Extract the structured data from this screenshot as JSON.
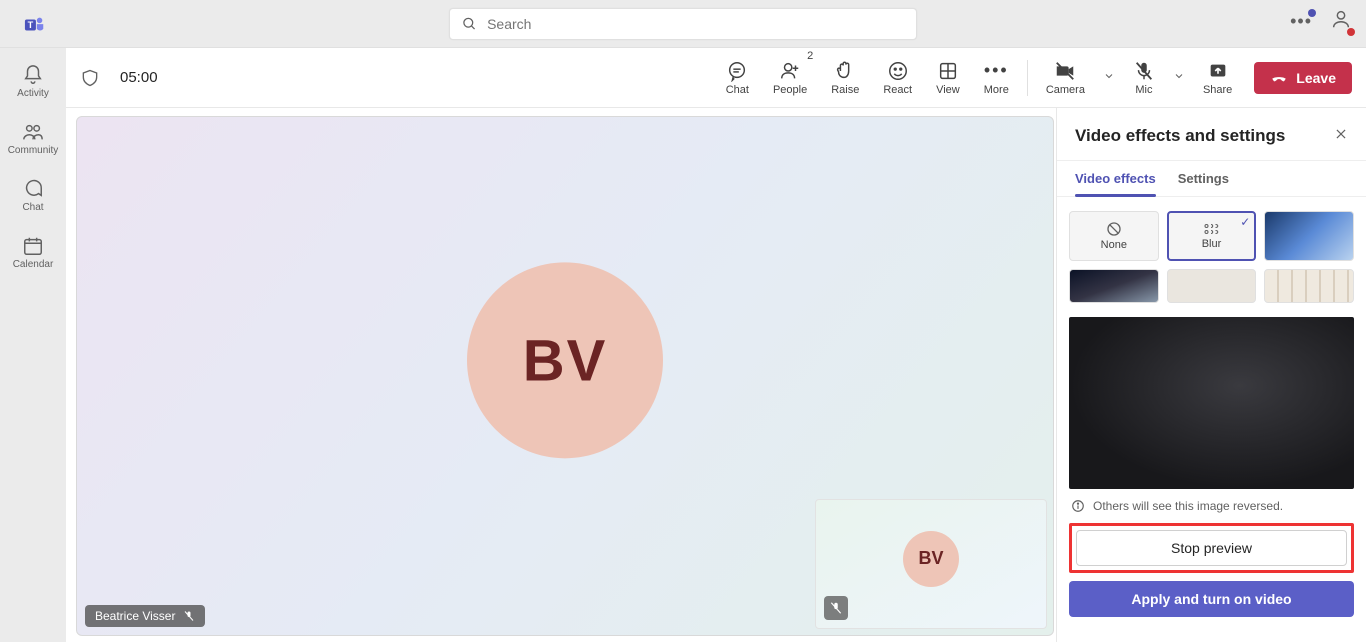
{
  "search": {
    "placeholder": "Search"
  },
  "rail": {
    "activity": "Activity",
    "community": "Community",
    "chat": "Chat",
    "calendar": "Calendar"
  },
  "meeting": {
    "time": "05:00",
    "toolbar": {
      "chat": "Chat",
      "people": "People",
      "people_count": "2",
      "raise": "Raise",
      "react": "React",
      "view": "View",
      "more": "More",
      "camera": "Camera",
      "mic": "Mic",
      "share": "Share",
      "leave": "Leave"
    },
    "participant_name": "Beatrice Visser",
    "avatar_initials": "BV",
    "self_initials": "BV"
  },
  "panel": {
    "title": "Video effects and settings",
    "tab_effects": "Video effects",
    "tab_settings": "Settings",
    "none": "None",
    "blur": "Blur",
    "info": "Others will see this image reversed.",
    "stop": "Stop preview",
    "apply": "Apply and turn on video"
  }
}
